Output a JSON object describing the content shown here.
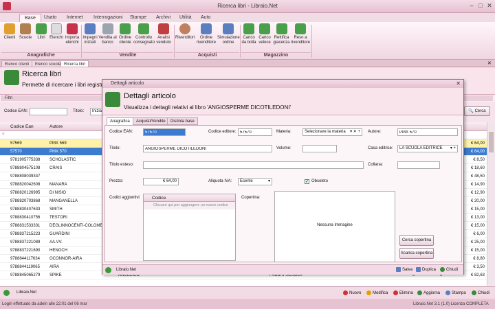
{
  "window": {
    "title": "Ricerca libri - Libraio.Net"
  },
  "ribbon": {
    "tabs": [
      "Base",
      "Usato",
      "Internet",
      "Interrogazioni",
      "Stampe",
      "Archivi",
      "Utilità",
      "Auto"
    ],
    "buttons": [
      {
        "label": "Clienti"
      },
      {
        "label": "Scuole"
      },
      {
        "label": "Libri"
      },
      {
        "label": "Elenchi"
      },
      {
        "label": "Importa elenchi"
      },
      {
        "label": "Impegni iniziali"
      },
      {
        "label": "Vendita al banco"
      },
      {
        "label": "Ordine cliente"
      },
      {
        "label": "Controllo consegnato"
      },
      {
        "label": "Analisi venduto"
      },
      {
        "label": "Rivenditori"
      },
      {
        "label": "Ordine rivenditore"
      },
      {
        "label": "Simulazione ordine"
      },
      {
        "label": "Carico da bolla"
      },
      {
        "label": "Carico veloce"
      },
      {
        "label": "Rettifica giacenza"
      },
      {
        "label": "Reso a rivenditore"
      }
    ],
    "groups": [
      "Anagrafiche",
      "Vendite",
      "Acquisti",
      "Magazzino"
    ]
  },
  "doc_tabs": [
    "Elenco clienti",
    "Elenco scuole",
    "Ricerca libri"
  ],
  "page": {
    "title": "Ricerca libri",
    "subtitle": "Permette di ricercare i libri registr",
    "filters_label": "Filtri"
  },
  "filters": {
    "ean_label": "Codice EAN:",
    "title_label": "Titolo:",
    "title_value": "Inizia",
    "search_button": "Cerca"
  },
  "grid": {
    "columns": [
      "Codice Ean",
      "Autore"
    ],
    "rows": [
      {
        "ean": "57569",
        "autore": "PMX 569",
        "price": "€ 64,00"
      },
      {
        "ean": "57570",
        "autore": "PMX 570",
        "price": "€ 64,00"
      },
      {
        "ean": "9781905775338",
        "autore": "SCHOLASTIC",
        "price": "€ 8,50"
      },
      {
        "ean": "9788804575108",
        "autore": "CRAIS",
        "price": "€ 18,60"
      },
      {
        "ean": "9788808039347",
        "autore": "",
        "price": "€ 48,50"
      },
      {
        "ean": "9788820042608",
        "autore": "MANARA",
        "price": "€ 14,90"
      },
      {
        "ean": "9788820126995",
        "autore": "DI NISIO",
        "price": "€ 12,90"
      },
      {
        "ean": "9788820703868",
        "autore": "MANGANELLA",
        "price": "€ 20,00"
      },
      {
        "ean": "9788830407633",
        "autore": "SMITH",
        "price": "€ 15,00"
      },
      {
        "ean": "9788830410756",
        "autore": "TESTORI",
        "price": "€ 13,00"
      },
      {
        "ean": "9788831533331",
        "autore": "DEGLINNOCENTI-COLOMB",
        "price": "€ 15,00"
      },
      {
        "ean": "9788837215223",
        "autore": "GUARDINI",
        "price": "€ 6,00"
      },
      {
        "ean": "9788837221089",
        "autore": "AA.VV.",
        "price": "€ 25,00"
      },
      {
        "ean": "9788837221690",
        "autore": "HENOCH",
        "price": "€ 15,00"
      },
      {
        "ean": "9788844117634",
        "autore": "OCONNOR-AIRA",
        "price": "€ 8,80"
      },
      {
        "ean": "9788844119065",
        "autore": "AIRA",
        "price": "€ 3,50"
      },
      {
        "ean": "9788845065279",
        "autore": "SPIKE",
        "price": "€ 82,63"
      }
    ],
    "last_row_extra": {
      "autore2": "ANGELICO",
      "editore": "FABBRI SCUOLA",
      "q1": "0",
      "q2": "0"
    }
  },
  "grid_footer": {
    "app": "Libraio.Net",
    "nuovo": "Nuovo",
    "modifica": "Modifica",
    "elimina": "Elimina",
    "aggiorna": "Aggiorna",
    "stampa": "Stampa",
    "chiudi": "Chiudi"
  },
  "status": {
    "login": "Login effettuato da adein alle 22:01 del 06 mar",
    "version": "Libraio.Net 3.1 (1.0) Licenza COMPLETA"
  },
  "dialog": {
    "title": "Dettagli articolo",
    "header_title": "Dettagli articolo",
    "header_subtitle": "Visualizza i dettagli relativi al libro 'ANGIOSPERME DICOTILEDONI'",
    "tabs": [
      "Anagrafica",
      "Acquisti/Vendite",
      "Distinta base"
    ],
    "fields": {
      "ean_label": "Codice EAN:",
      "ean_value": "57570",
      "editor_code_label": "Codice editore:",
      "editor_code_value": "57570",
      "materia_label": "Materia:",
      "materia_value": "Selezionare la materia",
      "autore_label": "Autore:",
      "autore_value": "PMX 570",
      "titolo_label": "Titolo:",
      "titolo_value": "ANGIOSPERME DICOTILEDONI",
      "volume_label": "Volume:",
      "casa_label": "Casa editrice:",
      "casa_value": "LA SCUOLA EDITRICE",
      "titolo_esteso_label": "Titolo esteso:",
      "collana_label": "Collana:",
      "prezzo_label": "Prezzo:",
      "prezzo_value": "€ 64,00",
      "iva_label": "Aliquota IVA:",
      "iva_value": "Esente",
      "obsoleto_label": "Obsoleto",
      "codici_label": "Codici aggiuntivi:",
      "codici_col": "Codice",
      "codici_placeholder": "Cliccare qui per aggiungere un nuovo codice",
      "copertina_label": "Copertina:",
      "no_image": "Nessuna Immagine",
      "cerca_copertina": "Cerca copertina",
      "scarica_copertina": "Scarica copertina"
    },
    "footer": {
      "app": "Libraio.Net",
      "salva": "Salva",
      "duplica": "Duplica",
      "chiudi": "Chiudi"
    }
  }
}
